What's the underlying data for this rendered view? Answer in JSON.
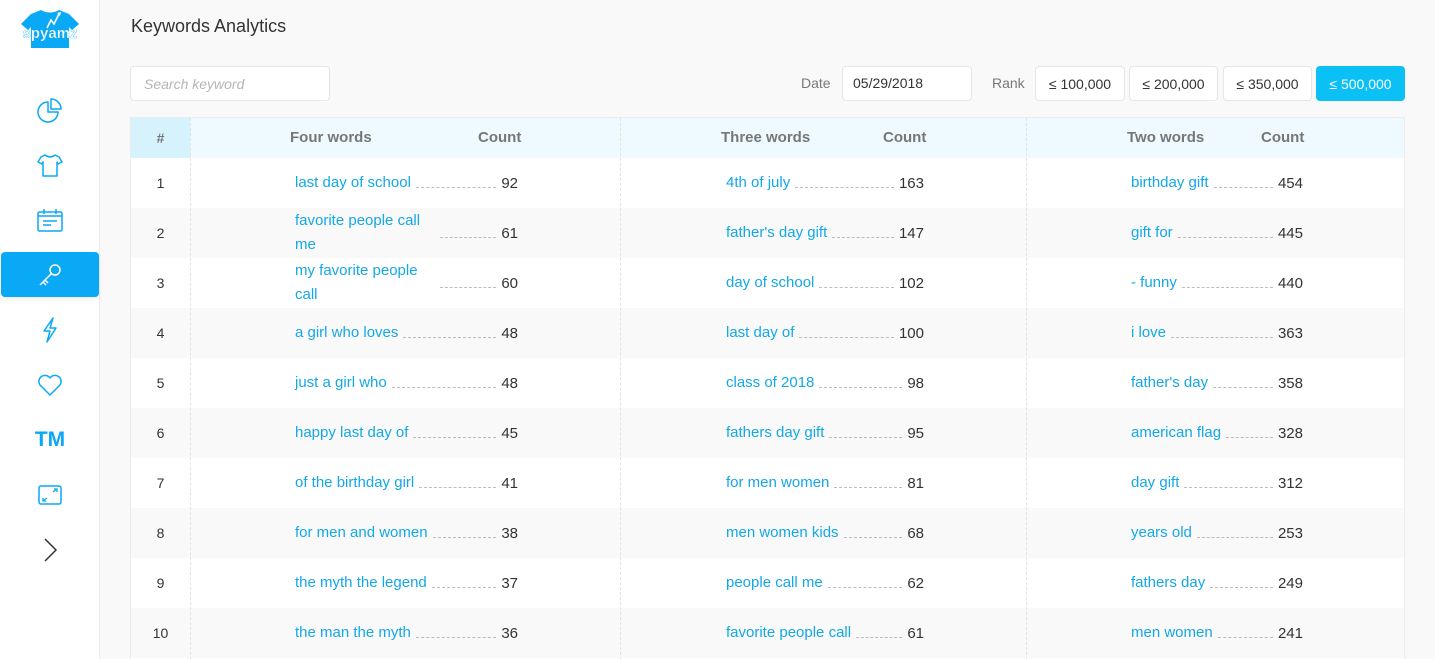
{
  "app": {
    "logo_text": "spyamz",
    "brand_color": "#0aa9f5"
  },
  "sidebar": {
    "items": [
      {
        "icon": "pie-chart-icon",
        "active": false
      },
      {
        "icon": "tshirt-icon",
        "active": false
      },
      {
        "icon": "calendar-icon",
        "active": false
      },
      {
        "icon": "key-icon",
        "active": true
      },
      {
        "icon": "lightning-icon",
        "active": false
      },
      {
        "icon": "heart-icon",
        "active": false
      },
      {
        "icon": "trademark-icon",
        "label": "TM",
        "active": false
      },
      {
        "icon": "expand-icon",
        "active": false
      },
      {
        "icon": "chevron-right-icon",
        "active": false
      }
    ]
  },
  "header": {
    "title": "Keywords Analytics"
  },
  "filters": {
    "search_placeholder": "Search keyword",
    "search_value": "",
    "date_label": "Date",
    "date_value": "05/29/2018",
    "rank_label": "Rank",
    "rank_options": [
      "≤ 100,000",
      "≤ 200,000",
      "≤ 350,000",
      "≤ 500,000"
    ],
    "rank_selected": "≤ 500,000",
    "accent_color": "#0ac0f5"
  },
  "table": {
    "headers": {
      "index": "#",
      "four_words": "Four words",
      "three_words": "Three words",
      "two_words": "Two words",
      "count": "Count"
    },
    "rows": [
      {
        "n": "1",
        "four": "last day of school",
        "four_count": "92",
        "three": "4th of july",
        "three_count": "163",
        "two": "birthday gift",
        "two_count": "454"
      },
      {
        "n": "2",
        "four": "favorite people call me",
        "four_count": "61",
        "three": "father's day gift",
        "three_count": "147",
        "two": "gift for",
        "two_count": "445"
      },
      {
        "n": "3",
        "four": "my favorite people call",
        "four_count": "60",
        "three": "day of school",
        "three_count": "102",
        "two": "- funny",
        "two_count": "440"
      },
      {
        "n": "4",
        "four": "a girl who loves",
        "four_count": "48",
        "three": "last day of",
        "three_count": "100",
        "two": "i love",
        "two_count": "363"
      },
      {
        "n": "5",
        "four": "just a girl who",
        "four_count": "48",
        "three": "class of 2018",
        "three_count": "98",
        "two": "father's day",
        "two_count": "358"
      },
      {
        "n": "6",
        "four": "happy last day of",
        "four_count": "45",
        "three": "fathers day gift",
        "three_count": "95",
        "two": "american flag",
        "two_count": "328"
      },
      {
        "n": "7",
        "four": "of the birthday girl",
        "four_count": "41",
        "three": "for men women",
        "three_count": "81",
        "two": "day gift",
        "two_count": "312"
      },
      {
        "n": "8",
        "four": "for men and women",
        "four_count": "38",
        "three": "men women kids",
        "three_count": "68",
        "two": "years old",
        "two_count": "253"
      },
      {
        "n": "9",
        "four": "the myth the legend",
        "four_count": "37",
        "three": "people call me",
        "three_count": "62",
        "two": "fathers day",
        "two_count": "249"
      },
      {
        "n": "10",
        "four": "the man the myth",
        "four_count": "36",
        "three": "favorite people call",
        "three_count": "61",
        "two": "men women",
        "two_count": "241"
      }
    ]
  }
}
